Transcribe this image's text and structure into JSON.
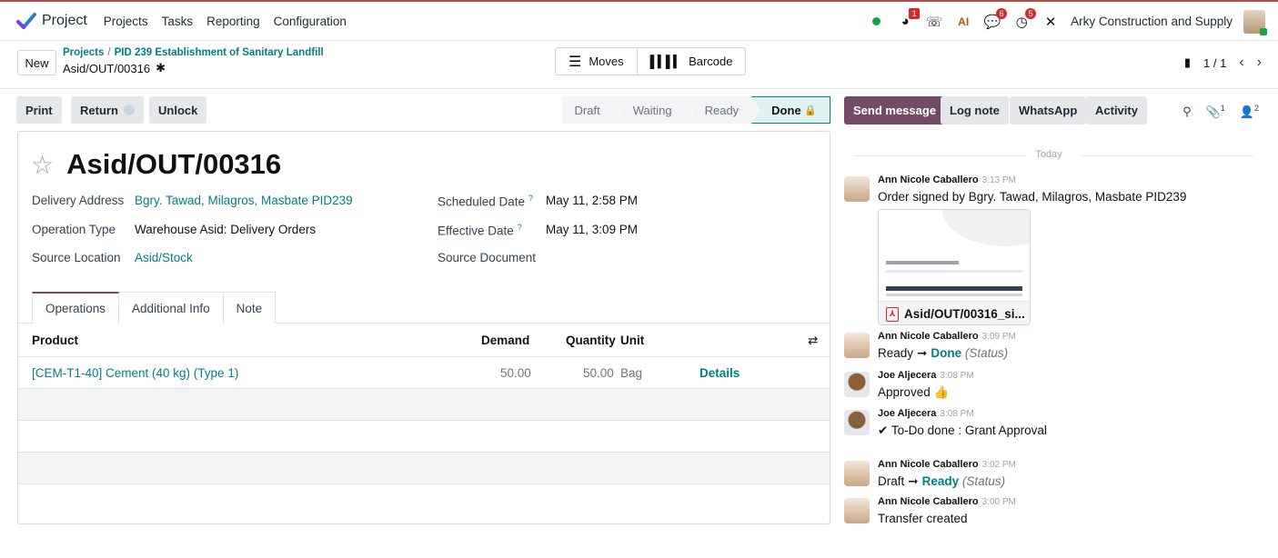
{
  "navbar": {
    "app_name": "Project",
    "menus": [
      "Projects",
      "Tasks",
      "Reporting",
      "Configuration"
    ],
    "badges": {
      "activity": "1",
      "messages": "6",
      "clock": "5"
    },
    "ai_label": "AI",
    "company": "Arky Construction and Supply"
  },
  "control": {
    "new_label": "New",
    "breadcrumb_root": "Projects",
    "breadcrumb_project": "PID 239 Establishment of Sanitary Landfill",
    "record_ref": "Asid/OUT/00316",
    "moves_label": "Moves",
    "barcode_label": "Barcode",
    "pager": "1 / 1"
  },
  "header": {
    "print": "Print",
    "return": "Return",
    "unlock": "Unlock",
    "stages": [
      "Draft",
      "Waiting",
      "Ready",
      "Done"
    ]
  },
  "form": {
    "name": "Asid/OUT/00316",
    "delivery_address_label": "Delivery Address",
    "delivery_address": "Bgry. Tawad, Milagros, Masbate PID239",
    "operation_type_label": "Operation Type",
    "operation_type": "Warehouse Asid: Delivery Orders",
    "source_location_label": "Source Location",
    "source_location": "Asid/Stock",
    "scheduled_date_label": "Scheduled Date",
    "scheduled_date": "May 11, 2:58 PM",
    "effective_date_label": "Effective Date",
    "effective_date": "May 11, 3:09 PM",
    "source_document_label": "Source Document",
    "help_mark": "?"
  },
  "tabs": [
    "Operations",
    "Additional Info",
    "Note"
  ],
  "table": {
    "headers": {
      "product": "Product",
      "demand": "Demand",
      "quantity": "Quantity",
      "unit": "Unit"
    },
    "rows": [
      {
        "product": "[CEM-T1-40] Cement (40 kg) (Type 1)",
        "demand": "50.00",
        "quantity": "50.00",
        "unit": "Bag",
        "action": "Details"
      }
    ]
  },
  "chatter": {
    "send_message": "Send message",
    "log_note": "Log note",
    "whatsapp": "WhatsApp",
    "activity": "Activity",
    "attachments_count": "1",
    "followers_count": "2",
    "today": "Today",
    "messages": [
      {
        "author": "Ann Nicole Caballero",
        "time": "3:13 PM",
        "text": "Order signed by Bgry. Tawad, Milagros, Masbate PID239",
        "attachment": "Asid/OUT/00316_si..."
      },
      {
        "author": "Ann Nicole Caballero",
        "time": "3:09 PM",
        "from": "Ready",
        "to": "Done",
        "field": "(Status)"
      },
      {
        "author": "Joe Aljecera",
        "time": "3:08 PM",
        "text": "Approved"
      },
      {
        "author": "Joe Aljecera",
        "time": "3:08 PM",
        "text": "To-Do done : Grant Approval"
      },
      {
        "author": "Ann Nicole Caballero",
        "time": "3:02 PM",
        "from": "Draft",
        "to": "Ready",
        "field": "(Status)"
      },
      {
        "author": "Ann Nicole Caballero",
        "time": "3:00 PM",
        "text": "Transfer created"
      }
    ]
  },
  "colors": {
    "accent": "#714b67",
    "link": "#017e84",
    "badge": "#dc2626",
    "online": "#16a34a"
  }
}
